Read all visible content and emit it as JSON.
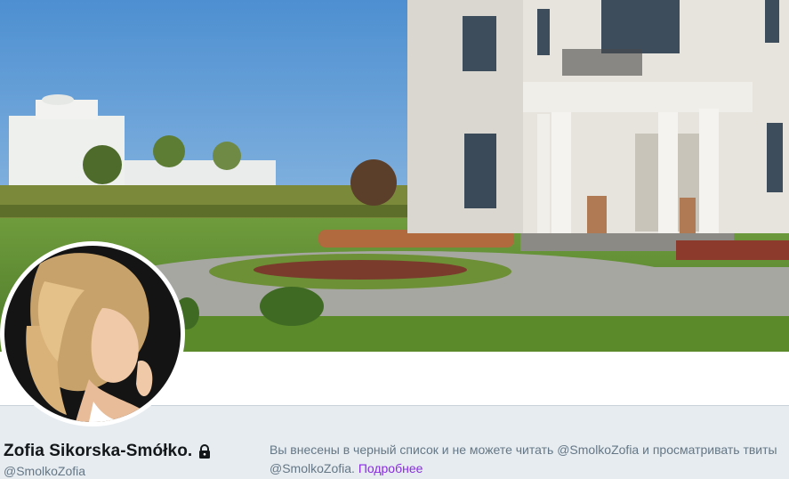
{
  "profile": {
    "display_name": "Zofia Sikorska-Smółko.",
    "screen_name": "@SmolkoZofia",
    "protected_icon": "lock-icon"
  },
  "banner": {
    "description_icon": "header-photo"
  },
  "blocked": {
    "message_part1": "Вы внесены в черный список и не можете читать @SmolkoZofia и просматривать твиты @SmolkoZofia.",
    "learn_more": "Подробнее"
  },
  "colors": {
    "name": "#14171a",
    "secondary_text": "#657786",
    "link": "#8a2be2",
    "profile_bar_bg": "#e6ecf0"
  }
}
